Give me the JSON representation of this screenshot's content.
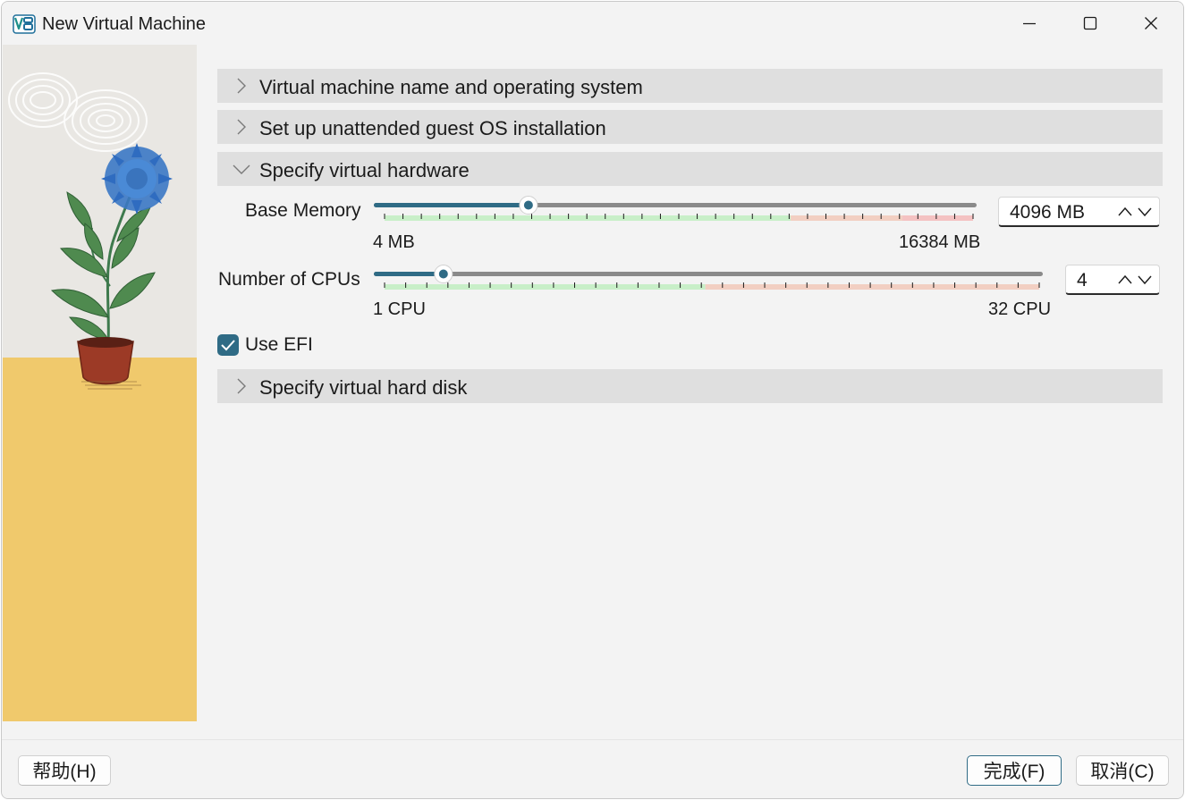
{
  "window": {
    "title": "New Virtual Machine",
    "controls": [
      "minimize-icon",
      "maximize-icon",
      "close-icon"
    ]
  },
  "sections": [
    {
      "label": "Virtual machine name and operating system",
      "expanded": false
    },
    {
      "label": "Set up unattended guest OS installation",
      "expanded": false
    },
    {
      "label": "Specify virtual hardware",
      "expanded": true
    },
    {
      "label": "Specify virtual hard disk",
      "expanded": false
    }
  ],
  "hardware": {
    "memory": {
      "label": "Base Memory",
      "min_label": "4 MB",
      "max_label": "16384 MB",
      "value": "4096 MB",
      "min": 4,
      "max": 16384,
      "current": 4096
    },
    "cpus": {
      "label": "Number of CPUs",
      "min_label": "1 CPU",
      "max_label": "32 CPU",
      "value": "4",
      "min": 1,
      "max": 32,
      "current": 4
    },
    "efi": {
      "label": "Use EFI",
      "checked": true
    }
  },
  "footer": {
    "help": "帮助(H)",
    "finish": "完成(F)",
    "cancel": "取消(C)"
  },
  "colors": {
    "accent": "#2f6b85",
    "track": "#8a8a8a",
    "safe_zone": "#c8efc8",
    "warn_zone": "#f2cfc2",
    "danger_zone": "#f4c2c2",
    "wall": "#e9e7e3",
    "floor": "#f0c96c"
  }
}
